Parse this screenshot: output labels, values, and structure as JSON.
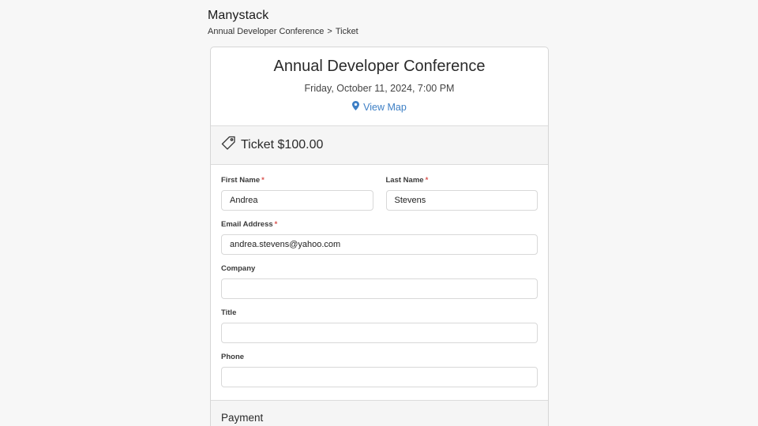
{
  "header": {
    "brand": "Manystack",
    "breadcrumb": [
      "Annual Developer Conference",
      ">",
      "Ticket"
    ]
  },
  "event": {
    "title": "Annual Developer Conference",
    "date": "Friday, October 11, 2024, 7:00 PM",
    "map_link": "View Map"
  },
  "ticket": {
    "label": "Ticket $100.00"
  },
  "form": {
    "first_name": {
      "label": "First Name",
      "required_mark": "*",
      "value": "Andrea"
    },
    "last_name": {
      "label": "Last Name",
      "required_mark": "*",
      "value": "Stevens"
    },
    "email": {
      "label": "Email Address",
      "required_mark": "*",
      "value": "andrea.stevens@yahoo.com"
    },
    "company": {
      "label": "Company",
      "value": ""
    },
    "title": {
      "label": "Title",
      "value": ""
    },
    "phone": {
      "label": "Phone",
      "value": ""
    }
  },
  "payment": {
    "title": "Payment"
  },
  "colors": {
    "link": "#3d7fc5",
    "required": "#d9534f"
  }
}
